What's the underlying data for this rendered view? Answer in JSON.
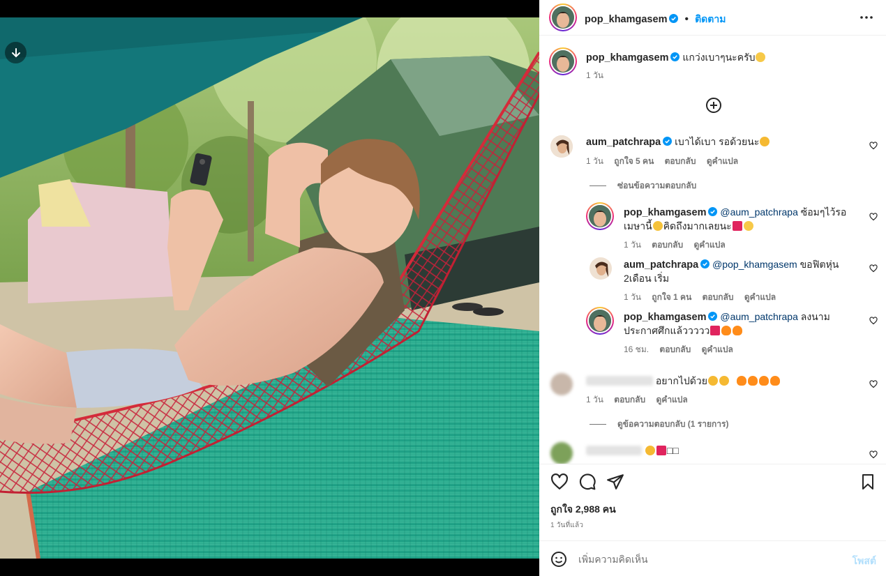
{
  "post": {
    "username": "pop_khamgasem",
    "follow_label": "ติดตาม",
    "separator": "•"
  },
  "caption": {
    "username": "pop_khamgasem",
    "text": "แกว่งเบาๆนะครับ",
    "time": "1 วัน"
  },
  "comments": [
    {
      "username": "aum_patchrapa",
      "text": "เบาได้เบา รอด้วยนะ",
      "time": "1 วัน",
      "likes": "ถูกใจ 5 คน",
      "reply_label": "ตอบกลับ",
      "translate_label": "ดูคำแปล"
    }
  ],
  "hide_replies": "ซ่อนข้อความตอบกลับ",
  "replies": [
    {
      "username": "pop_khamgasem",
      "mention": "@aum_patchrapa",
      "text_line1": "ซ้อมๆไว้รอ",
      "text_line2": "เมษานี้",
      "text_line2b": "คิดถึงมากเลยนะ",
      "time": "1 วัน",
      "reply_label": "ตอบกลับ",
      "translate_label": "ดูคำแปล"
    },
    {
      "username": "aum_patchrapa",
      "mention": "@pop_khamgasem",
      "text_line1": "ขอฟิตหุ่น",
      "text_line2": "2เดือน เริ่ม",
      "time": "1 วัน",
      "likes": "ถูกใจ 1 คน",
      "reply_label": "ตอบกลับ",
      "translate_label": "ดูคำแปล"
    },
    {
      "username": "pop_khamgasem",
      "mention": "@aum_patchrapa",
      "text_line1": "ลงนาม",
      "text_line2": "ประกาศศึกแล้ววววว",
      "time": "16 ชม.",
      "reply_label": "ตอบกลับ",
      "translate_label": "ดูคำแปล"
    }
  ],
  "other_comment_1": {
    "text": "อยากไปด้วย",
    "time": "1 วัน",
    "reply_label": "ตอบกลับ",
    "translate_label": "ดูคำแปล"
  },
  "view_replies": "ดูข้อความตอบกลับ (1 รายการ)",
  "other_comment_2": {
    "text": "□□"
  },
  "footer": {
    "likes": "ถูกใจ 2,988 คน",
    "date": "1 วันที่แล้ว",
    "comment_placeholder": "เพิ่มความคิดเห็น",
    "post_label": "โพสต์"
  },
  "colors": {
    "link": "#0095f6",
    "mention": "#00376b",
    "muted": "#737373",
    "hammock": "#d42b3a",
    "tarp": "#13777a",
    "mat": "#1faa8c"
  }
}
